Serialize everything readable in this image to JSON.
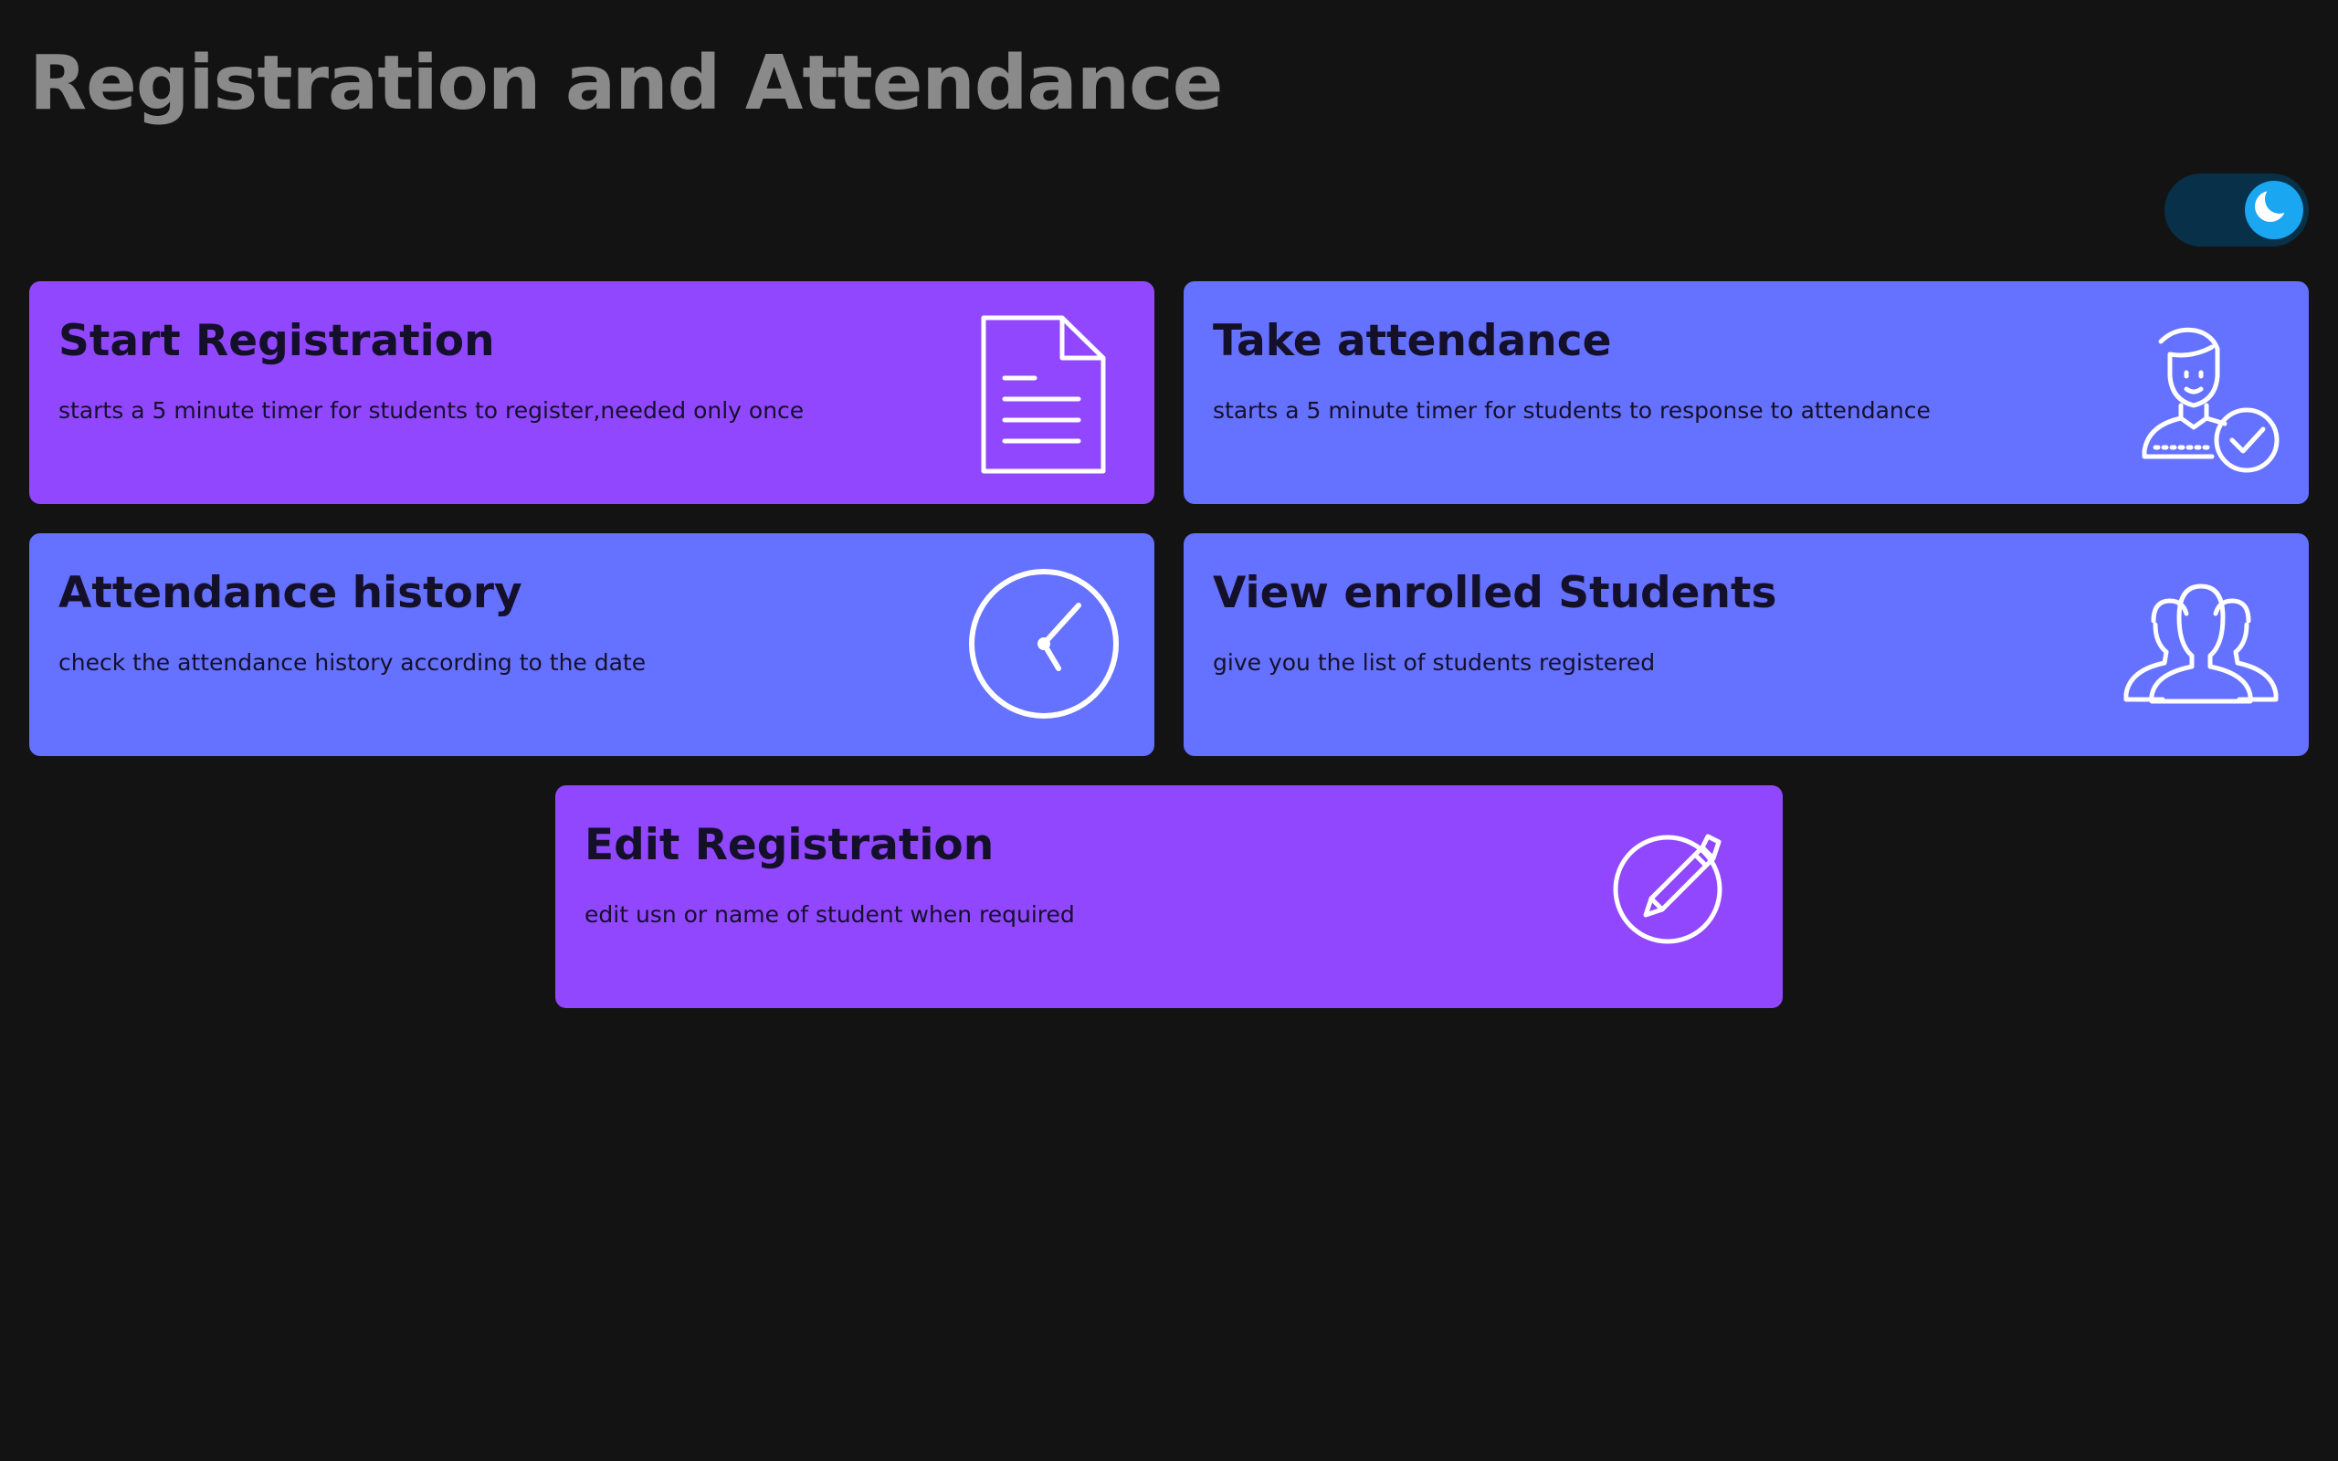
{
  "header": {
    "title": "Registration and Attendance"
  },
  "theme_toggle": {
    "state": "dark",
    "icon": "moon-icon",
    "track_color": "#083048",
    "knob_color": "#1aa6f0"
  },
  "cards": [
    {
      "id": "start-registration",
      "title": "Start Registration",
      "description": "starts a 5 minute timer for students to register,needed only once",
      "icon": "document-icon",
      "color": "#9147fe"
    },
    {
      "id": "take-attendance",
      "title": "Take attendance",
      "description": "starts a 5 minute timer for students to response to attendance",
      "icon": "user-check-icon",
      "color": "#6571ff"
    },
    {
      "id": "attendance-history",
      "title": "Attendance history",
      "description": "check the attendance history according to the date",
      "icon": "clock-icon",
      "color": "#6571ff"
    },
    {
      "id": "view-enrolled-students",
      "title": "View enrolled Students",
      "description": "give you the list of students registered",
      "icon": "users-group-icon",
      "color": "#6571ff"
    },
    {
      "id": "edit-registration",
      "title": "Edit Registration",
      "description": "edit usn or name of student when required",
      "icon": "pencil-circle-icon",
      "color": "#9147fe"
    }
  ]
}
